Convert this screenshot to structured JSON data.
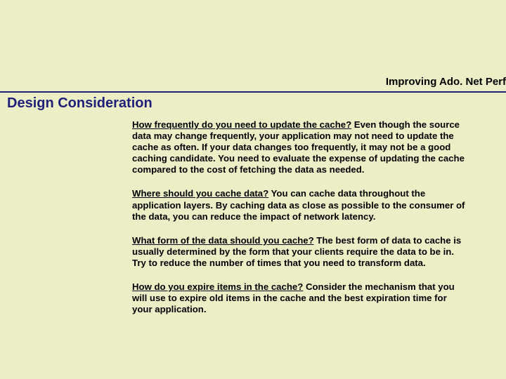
{
  "breadcrumb": "Improving Ado. Net Perf",
  "title": "Design Consideration",
  "paragraphs": [
    {
      "lead": "How frequently do you need to update the cache?",
      "rest": " Even though the source data may change frequently, your application may not need to update the cache as often. If your data changes too frequently, it may not be a good caching candidate. You need to evaluate the expense of updating the cache compared to the cost of fetching the data as needed."
    },
    {
      "lead": "Where should you cache data?",
      "rest": " You can cache data throughout the application layers. By caching data as close as possible to the consumer of the data, you can reduce the impact of network latency."
    },
    {
      "lead": "What form of the data should you cache?",
      "rest": " The best form of data to cache is usually determined by the form that your clients require the data to be in. Try to reduce the number of times that you need to transform data."
    },
    {
      "lead": "How do you expire items in the cache?",
      "rest": " Consider the mechanism that you will use to expire old items in the cache and the best expiration time for your application."
    }
  ]
}
